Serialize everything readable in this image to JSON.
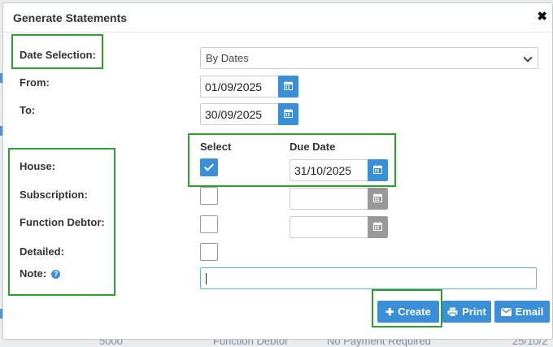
{
  "dialog": {
    "title": "Generate Statements",
    "close_symbol": "✖"
  },
  "labels": {
    "date_selection": "Date Selection:",
    "from": "From:",
    "to": "To:",
    "house": "House:",
    "subscription": "Subscription:",
    "function_debtor": "Function Debtor:",
    "detailed": "Detailed:",
    "note": "Note:"
  },
  "date_selection": {
    "value": "By Dates",
    "icon": "chevron-down-icon"
  },
  "dates": {
    "from": "01/09/2025",
    "to": "30/09/2025"
  },
  "columns": {
    "select": "Select",
    "due_date": "Due Date"
  },
  "rows": [
    {
      "name": "house",
      "selected": true,
      "due_date": "31/10/2025",
      "enabled": true
    },
    {
      "name": "subscription",
      "selected": false,
      "due_date": "",
      "enabled": false
    },
    {
      "name": "function_debtor",
      "selected": false,
      "due_date": "",
      "enabled": false
    }
  ],
  "detailed": {
    "selected": false
  },
  "note": {
    "value": "",
    "help_icon": "?"
  },
  "buttons": {
    "create": "Create",
    "print": "Print",
    "email": "Email"
  },
  "background": {
    "footer_cells": [
      "5000",
      "Function Debtor",
      "No Payment Required",
      "25/10/2"
    ]
  },
  "colors": {
    "primary": "#3a8fd6",
    "highlight": "#2ea02e",
    "disabled": "#999999"
  }
}
